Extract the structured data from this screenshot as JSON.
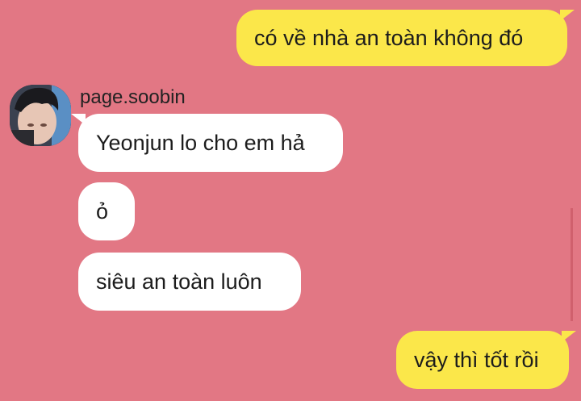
{
  "chat": {
    "contact_name": "page.soobin",
    "messages": [
      {
        "direction": "outgoing",
        "text": "có về nhà an toàn không đó"
      },
      {
        "direction": "incoming",
        "text": "Yeonjun lo cho em hả"
      },
      {
        "direction": "incoming",
        "text": "ỏ"
      },
      {
        "direction": "incoming",
        "text": "siêu an toàn luôn"
      },
      {
        "direction": "outgoing",
        "text": "vậy thì tốt rồi"
      }
    ]
  },
  "colors": {
    "background": "#e27784",
    "outgoing_bubble": "#fbe74a",
    "incoming_bubble": "#ffffff"
  }
}
